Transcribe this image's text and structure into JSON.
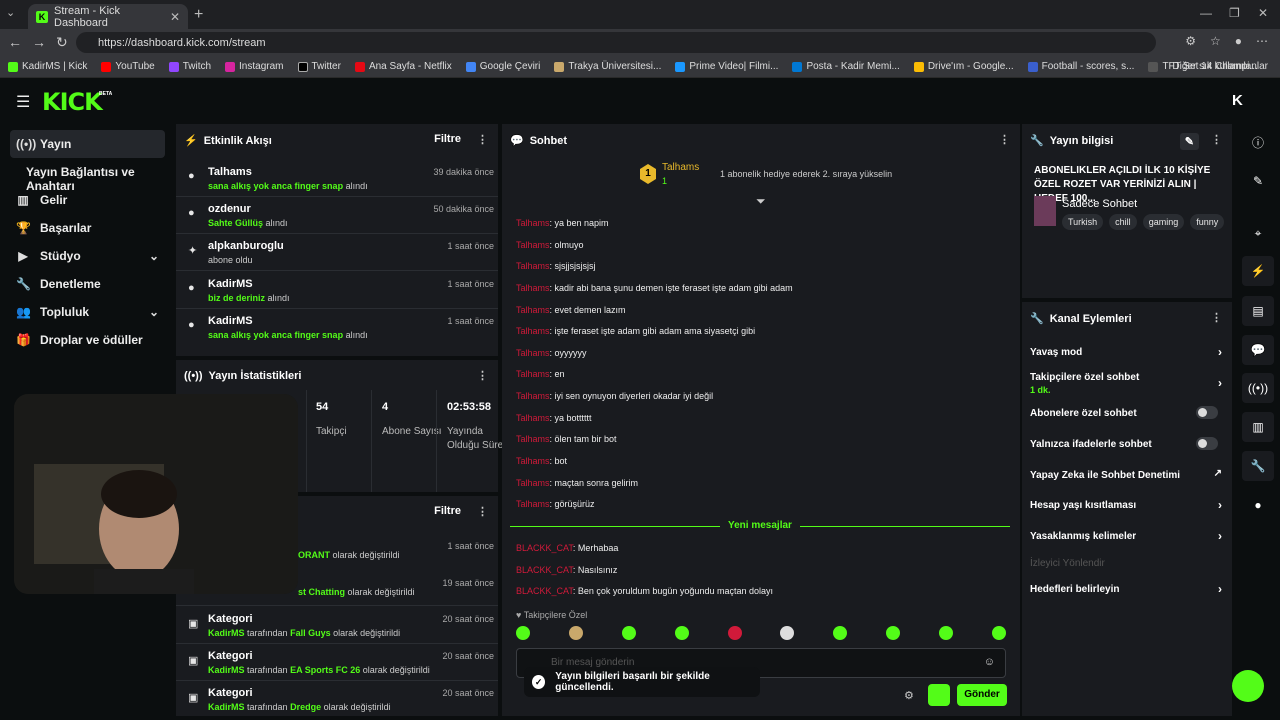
{
  "browser": {
    "tab_title": "Stream - Kick Dashboard",
    "url": "https://dashboard.kick.com/stream",
    "bookmarks": [
      "KadirMS | Kick",
      "YouTube",
      "Twitch",
      "Instagram",
      "Twitter",
      "Ana Sayfa - Netflix",
      "Google Çeviri",
      "Trakya Üniversitesi...",
      "Prime Video| Filmi...",
      "Posta - Kadir Memi...",
      "Drive'ım - Google...",
      "Football - scores, s...",
      "TFT Set 14 Champi..."
    ],
    "bookmarks_other": "Diğer sık kullanılanlar"
  },
  "brand": {
    "logo": "KICK",
    "beta": "BETA",
    "accent": "#53fc18"
  },
  "sidebar": {
    "items": [
      {
        "label": "Yayın",
        "icon": "broadcast-icon"
      },
      {
        "label": "Yayın Bağlantısı ve Anahtarı"
      },
      {
        "label": "Gelir",
        "icon": "chart-icon"
      },
      {
        "label": "Başarılar",
        "icon": "trophy-icon"
      },
      {
        "label": "Stüdyo",
        "icon": "video-icon"
      },
      {
        "label": "Denetleme",
        "icon": "wrench-icon"
      },
      {
        "label": "Topluluk",
        "icon": "people-icon"
      },
      {
        "label": "Droplar ve ödüller",
        "icon": "gift-icon"
      }
    ]
  },
  "activity": {
    "title": "Etkinlik Akışı",
    "filter": "Filtre",
    "items": [
      {
        "name": "Talhams",
        "reward": "sana alkış yok anca finger snap",
        "suffix": "alındı",
        "time": "39 dakika önce"
      },
      {
        "name": "ozdenur",
        "reward": "Sahte Güllüş",
        "suffix": "alındı",
        "time": "50 dakika önce"
      },
      {
        "name": "alpkanburoglu",
        "reward": "",
        "suffix": "abone oldu",
        "time": "1 saat önce"
      },
      {
        "name": "KadirMS",
        "reward": "biz de deriniz",
        "suffix": "alındı",
        "time": "1 saat önce"
      },
      {
        "name": "KadirMS",
        "reward": "sana alkış yok anca finger snap",
        "suffix": "alındı",
        "time": "1 saat önce"
      }
    ]
  },
  "stats": {
    "title": "Yayın İstatistikleri",
    "items": [
      {
        "value": "54",
        "label": "Takipçi"
      },
      {
        "value": "4",
        "label": "Abone Sayısı"
      },
      {
        "value": "02:53:58",
        "label": "Yayında Olduğu Süre"
      }
    ]
  },
  "history": {
    "filter": "Filtre",
    "items": [
      {
        "title": "",
        "user": "",
        "game": "ORANT",
        "suffix": "olarak değiştirildi",
        "time": "1 saat önce"
      },
      {
        "title": "",
        "user": "",
        "game": "st Chatting",
        "suffix": "olarak değiştirildi",
        "time": "19 saat önce"
      },
      {
        "title": "Kategori",
        "user": "KadirMS",
        "mid": "tarafından",
        "game": "Fall Guys",
        "suffix": "olarak değiştirildi",
        "time": "20 saat önce"
      },
      {
        "title": "Kategori",
        "user": "KadirMS",
        "mid": "tarafından",
        "game": "EA Sports FC 26",
        "suffix": "olarak değiştirildi",
        "time": "20 saat önce"
      },
      {
        "title": "Kategori",
        "user": "KadirMS",
        "mid": "tarafından",
        "game": "Dredge",
        "suffix": "olarak değiştirildi",
        "time": "20 saat önce"
      }
    ]
  },
  "chat": {
    "title": "Sohbet",
    "pinned_user": "Talhams",
    "pinned_count": "1",
    "pinned_text": "1 abonelik hediye ederek 2. sıraya yükselin",
    "messages": [
      {
        "user": "Talhams",
        "text": ": ya ben napim"
      },
      {
        "user": "Talhams",
        "text": ": olmuyo"
      },
      {
        "user": "Talhams",
        "text": ": sjsjjsjsjsjsj"
      },
      {
        "user": "Talhams",
        "text": ": kadir abi bana şunu demen işte feraset işte adam gibi adam"
      },
      {
        "user": "Talhams",
        "text": ": evet demen lazım"
      },
      {
        "user": "Talhams",
        "text": ": işte feraset işte adam gibi adam ama siyasetçi gibi"
      },
      {
        "user": "Talhams",
        "text": ": oyyyyyy"
      },
      {
        "user": "Talhams",
        "text": ": en"
      },
      {
        "user": "Talhams",
        "text": ": iyi sen oynuyon diyerleri okadar iyi değil"
      },
      {
        "user": "Talhams",
        "text": ": ya botttttt"
      },
      {
        "user": "Talhams",
        "text": ": ölen tam bir bot"
      },
      {
        "user": "Talhams",
        "text": ": bot"
      },
      {
        "user": "Talhams",
        "text": ": maçtan sonra gelirim"
      },
      {
        "user": "Talhams",
        "text": ": görüşürüz"
      }
    ],
    "new_label": "Yeni mesajlar",
    "new_messages": [
      {
        "user": "BLACKK_CAT",
        "text": ": Merhabaa"
      },
      {
        "user": "BLACKK_CAT",
        "text": ": Nasılsınız"
      },
      {
        "user": "BLACKK_CAT",
        "text": ": Ben çok yoruldum bugün yoğundu maçtan dolayı"
      }
    ],
    "followers_only": "Takipçilere Özel",
    "input_placeholder": "Bir mesaj gönderin",
    "send": "Gönder"
  },
  "toast": "Yayın bilgileri başarılı bir şekilde güncellendi.",
  "stream_info": {
    "title": "Yayın bilgisi",
    "stream_title": "ABONELIKLER AÇILDI İLK 10 KİŞİYE ÖZEL ROZET VAR YERİNİZİ ALIN | HEDEF 100...",
    "category": "Sadece Sohbet",
    "tags": [
      "Turkish",
      "chill",
      "gaming",
      "funny"
    ]
  },
  "channel_actions": {
    "title": "Kanal Eylemleri",
    "slow": "Yavaş mod",
    "followers": "Takipçilere özel sohbet",
    "followers_sub": "1 dk.",
    "subs": "Abonelere özel sohbet",
    "emotes": "Yalnızca ifadelerle sohbet",
    "ai": "Yapay Zeka ile Sohbet Denetimi",
    "age": "Hesap yaşı kısıtlaması",
    "banned": "Yasaklanmış kelimeler",
    "redirect": "İzleyici Yönlendir",
    "goals": "Hedefleri belirleyin"
  }
}
